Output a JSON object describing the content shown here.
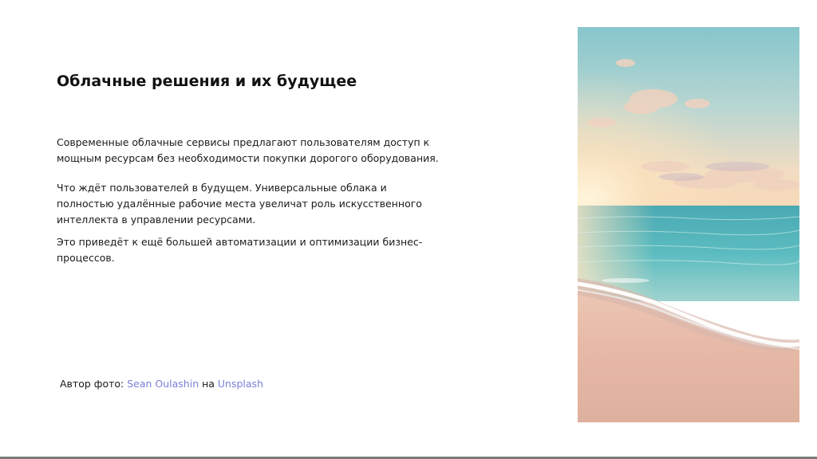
{
  "slide": {
    "title": "Облачные решения и их будущее",
    "paragraphs": [
      "Современные облачные сервисы предлагают пользователям доступ к мощным ресурсам без необходимости покупки дорогого оборудования.",
      "Что ждёт пользователей в будущем. Универсальные облака и полностью удалённые рабочие места увеличат роль искусственного интеллекта в управлении ресурсами.",
      "Это приведёт к ещё большей автоматизации и оптимизации бизнес-процессов."
    ],
    "credit": {
      "prefix": "Автор фото: ",
      "author": "Sean Oulashin",
      "middle": " на ",
      "source": "Unsplash"
    },
    "photo": {
      "subject": "beach-sunset-photo"
    }
  },
  "colors": {
    "link": "#7b7fd8",
    "text": "#1a1a1a",
    "sky": "#8fc8cf",
    "sea": "#49b3b8",
    "sand": "#e6b9a8"
  }
}
